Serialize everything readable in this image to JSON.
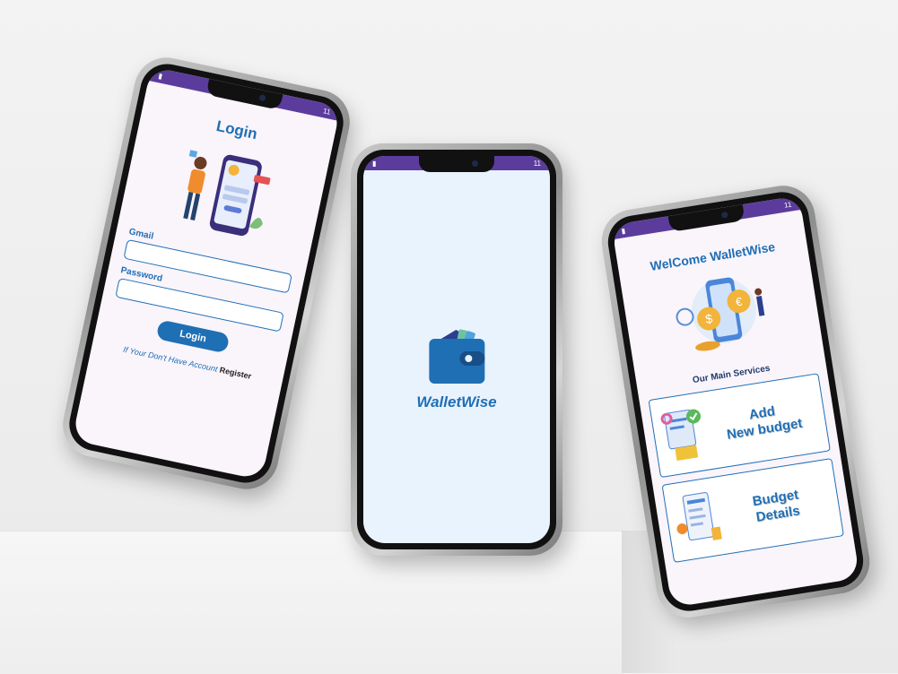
{
  "status": {
    "time": "11"
  },
  "login": {
    "title": "Login",
    "email_label": "Gmail",
    "password_label": "Password",
    "button": "Login",
    "no_account_text": "If Your Don't Have Account",
    "register_link": "Register"
  },
  "splash": {
    "app_name": "WalletWise"
  },
  "home": {
    "title": "WelCome WalletWise",
    "services_heading": "Our Main Services",
    "cards": [
      {
        "line1": "Add",
        "line2": "New budget"
      },
      {
        "line1": "Budget",
        "line2": "Details"
      }
    ]
  },
  "colors": {
    "accent": "#1f6fb5",
    "statusbar": "#5b3c9c",
    "screen_bg": "#faf4fb",
    "splash_bg": "#e9f3fd"
  }
}
